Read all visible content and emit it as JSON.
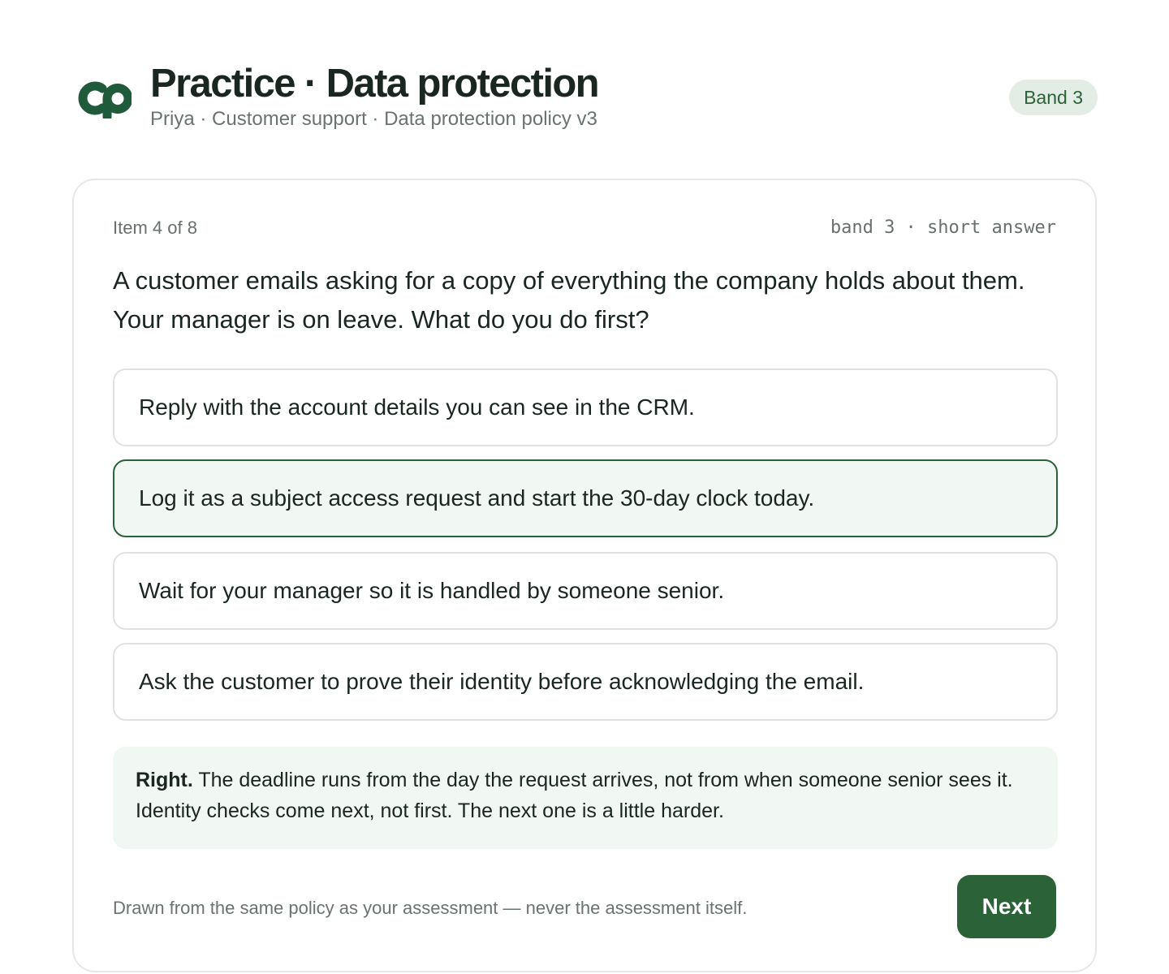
{
  "header": {
    "logo_icon": "cp-logo-icon",
    "title": "Practice · Data protection",
    "subtitle": "Priya · Customer support · Data protection policy v3",
    "band_badge": "Band 3"
  },
  "item": {
    "count_label": "Item 4 of 8",
    "meta_label": "band 3 · short answer",
    "question": "A customer emails asking for a copy of everything the company holds about them. Your manager is on leave. What do you do first?",
    "options": [
      {
        "label": "Reply with the account details you can see in the CRM.",
        "selected": false
      },
      {
        "label": "Log it as a subject access request and start the 30-day clock today.",
        "selected": true
      },
      {
        "label": "Wait for your manager so it is handled by someone senior.",
        "selected": false
      },
      {
        "label": "Ask the customer to prove their identity before acknowledging the email.",
        "selected": false
      }
    ]
  },
  "feedback": {
    "verdict": "Right.",
    "text": " The deadline runs from the day the request arrives, not from when someone senior sees it. Identity checks come next, not first. The next one is a little harder."
  },
  "footer": {
    "note": "Drawn from the same policy as your assessment — never the assessment itself.",
    "next_label": "Next"
  },
  "colors": {
    "brand": "#1f5a3a",
    "accent": "#2c6238",
    "selected_bg": "#f1f7f2",
    "badge_bg": "#e3ece5"
  }
}
